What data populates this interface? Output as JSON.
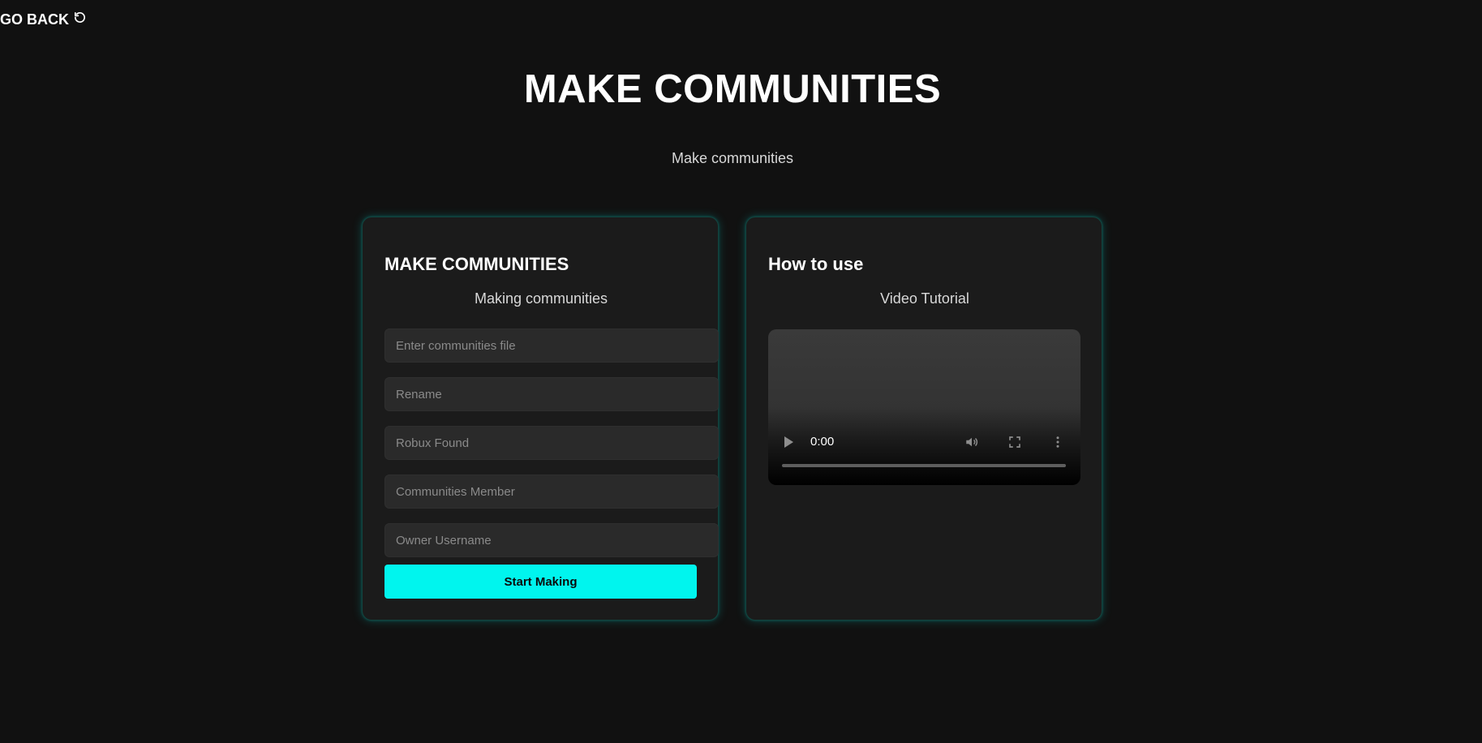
{
  "nav": {
    "go_back_label": "GO BACK"
  },
  "header": {
    "title": "MAKE COMMUNITIES",
    "subtitle": "Make communities"
  },
  "form_card": {
    "title": "MAKE COMMUNITIES",
    "subtitle": "Making communities",
    "fields": [
      {
        "placeholder": "Enter communities file",
        "value": ""
      },
      {
        "placeholder": "Rename",
        "value": ""
      },
      {
        "placeholder": "Robux Found",
        "value": ""
      },
      {
        "placeholder": "Communities Member",
        "value": ""
      },
      {
        "placeholder": "Owner Username",
        "value": ""
      }
    ],
    "submit_label": "Start Making"
  },
  "help_card": {
    "title": "How to use",
    "subtitle": "Video Tutorial",
    "video": {
      "time": "0:00",
      "progress": 0
    }
  },
  "colors": {
    "background": "#111111",
    "card": "#1b1b1b",
    "accent": "#00f5ee",
    "field": "#2a2a2a"
  },
  "icons": [
    "refresh-icon",
    "play-icon",
    "volume-icon",
    "fullscreen-icon",
    "more-vert-icon"
  ]
}
